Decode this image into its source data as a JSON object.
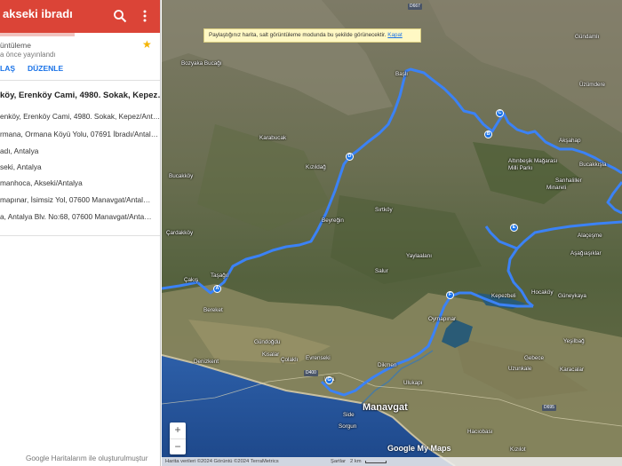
{
  "panel": {
    "title": "akseki ibradı",
    "views_line": "üntüleme",
    "published_line": "a önce yayınlandı",
    "share_label": "LAŞ",
    "edit_label": "DÜZENLE",
    "route_title": "köy, Erenköy Cami, 4980. Sokak, Kepez…",
    "places": [
      "enköy, Erenköy Cami, 4980. Sokak, Kepez/Ant…",
      "rmana, Ormana Köyü Yolu, 07691 İbradı/Antal…",
      "adı, Antalya",
      "seki, Antalya",
      "manhoca, Akseki/Antalya",
      "mapınar, İsimsiz Yol, 07600 Manavgat/Antal…",
      "a, Antalya Blv. No:68, 07600 Manavgat/Anta…"
    ],
    "footer_note": "Google Haritalarım ile oluşturulmuştur"
  },
  "map": {
    "notice_text": "Paylaştığınız harita, salt görüntüleme modunda bu şekilde görünecektir.",
    "notice_link": "Kapat",
    "zoom_in": "+",
    "zoom_out": "−",
    "logo": "Google My Maps",
    "attribution": "Harita verileri ©2024 Görüntü ©2024 TerraMetrics",
    "terms": "Şartlar",
    "scale": "2 km",
    "route_color": "#3b82f6",
    "labels": {
      "bozyaka": "Bozyaka Bucağı",
      "basli": "Başlı",
      "gundamlı": "Gündamlı",
      "uzumdere": "Üzümdere",
      "akşahap": "Akşahap",
      "altinbesik": "Altınbeşik Mağarası Milli Parkı",
      "bucakkisla": "Bucakkışla",
      "karabucak": "Karabucak",
      "kizildag": "Kızıldağ",
      "bucakkoy": "Bucakköy",
      "sarihaliller": "Sarıhaliller",
      "minareli": "Minareli",
      "beyregin": "Beyreğin",
      "sirtkoy": "Sırtköy",
      "cardakkoy": "Çardakköy",
      "yaylaalani": "Yaylaalanı",
      "salur": "Salur",
      "alacasme": "Alaçeşme",
      "asagiaşıklar": "Aşağıaşıklar",
      "tasagil": "Taşağıl",
      "cakis": "Çakış",
      "bereket": "Bereket",
      "kepezbeli": "Kepezbeli",
      "hocakoy": "Hocaköy",
      "guneykaya": "Güneykaya",
      "oymapinar": "Oymapınar",
      "gundogdu": "Gündoğdu",
      "kisalar": "Kisalar",
      "colakli": "Çolaklı",
      "evrenseki": "Evrenseki",
      "denizkent": "Denizkent",
      "dikmen": "Dikmen",
      "ulukapi": "Ulukapı",
      "manavgat": "Manavgat",
      "side": "Side",
      "gebece": "Gebece",
      "haciobasi": "Hacıobası",
      "uzunkale": "Uzunkale",
      "yesilbag": "Yeşilbağ",
      "karacalar": "Karacalar",
      "ilica": "Ilıca",
      "sorgun": "Sorgun",
      "kizilot": "Kızılot"
    },
    "roads": {
      "d667": "D667",
      "d400": "D400",
      "d695": "D695"
    },
    "markers": [
      "A",
      "B",
      "C",
      "D",
      "E",
      "F",
      "G"
    ]
  }
}
